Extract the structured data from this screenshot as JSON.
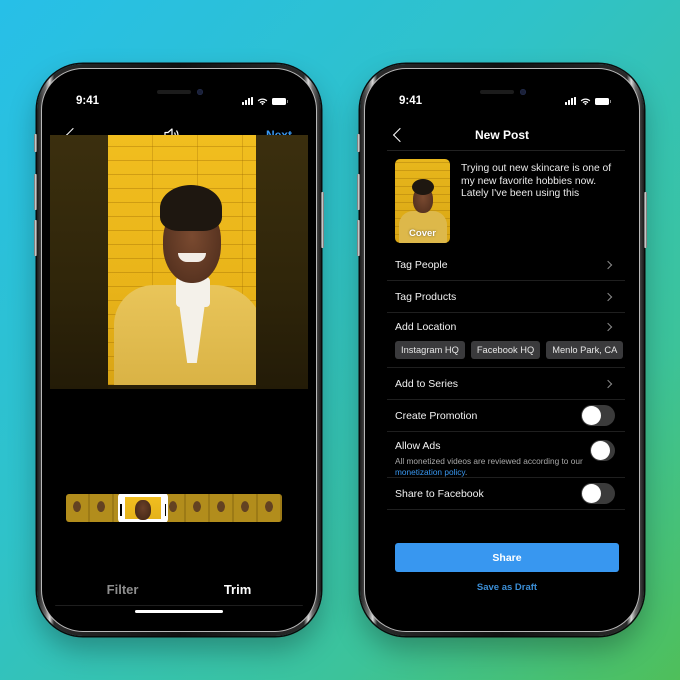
{
  "theme": {
    "accent": "#3897f0",
    "background_gradient": [
      "#27bfe8",
      "#4fbf5a"
    ],
    "screen_bg": "#000000"
  },
  "editor_screen": {
    "status_bar": {
      "time": "9:41",
      "icons": [
        "signal-icon",
        "wifi-icon",
        "battery-icon"
      ]
    },
    "nav": {
      "back_icon": "chevron-left-icon",
      "center_icon": "speaker-icon",
      "next_label": "Next"
    },
    "video": {
      "description": "Smiling woman in yellow jacket against yellow brick wall"
    },
    "filmstrip": {
      "frames": 9,
      "selected_frame_index": 1
    },
    "tabs": [
      {
        "label": "Filter",
        "active": false
      },
      {
        "label": "Trim",
        "active": true
      }
    ]
  },
  "post_screen": {
    "status_bar": {
      "time": "9:41",
      "icons": [
        "signal-icon",
        "wifi-icon",
        "battery-icon"
      ]
    },
    "nav": {
      "back_icon": "chevron-left-icon",
      "title": "New Post"
    },
    "cover": {
      "label": "Cover"
    },
    "caption": "Trying out new skincare is one of my new favorite hobbies now. Lately I've been using this",
    "rows": [
      {
        "label": "Tag People",
        "type": "link"
      },
      {
        "label": "Tag Products",
        "type": "link"
      },
      {
        "label": "Add Location",
        "type": "link"
      }
    ],
    "location_suggestions": [
      "Instagram HQ",
      "Facebook HQ",
      "Menlo Park, CA"
    ],
    "add_to_series": {
      "label": "Add to Series"
    },
    "toggles": {
      "create_promotion": {
        "label": "Create Promotion",
        "on": false
      },
      "allow_ads": {
        "label": "Allow Ads",
        "on": false,
        "subtext": "All monetized videos are reviewed according to our ",
        "link_text": "monetization policy",
        "suffix": "."
      },
      "share_facebook": {
        "label": "Share to Facebook",
        "on": false
      }
    },
    "share_button": "Share",
    "draft_link": "Save as Draft"
  }
}
